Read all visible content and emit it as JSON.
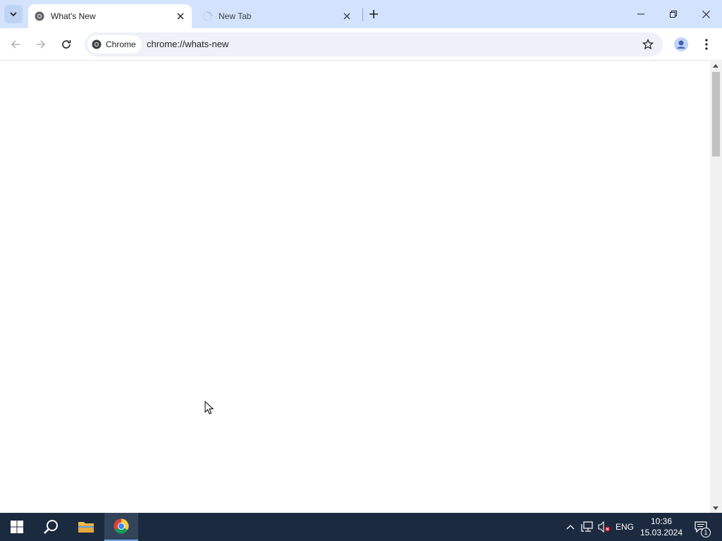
{
  "tabs": [
    {
      "title": "What's New",
      "favicon": "chrome-logo-icon",
      "active": true
    },
    {
      "title": "New Tab",
      "favicon": "loading-spinner-icon",
      "active": false
    }
  ],
  "omnibox": {
    "chip_label": "Chrome",
    "url": "chrome://whats-new"
  },
  "taskbar": {
    "language": "ENG",
    "time": "10:36",
    "date": "15.03.2024",
    "notification_count": "1"
  },
  "colors": {
    "tabstrip_bg": "#d3e3fd",
    "omnibox_bg": "#eef1f8",
    "taskbar_bg": "#1c2a3f"
  }
}
